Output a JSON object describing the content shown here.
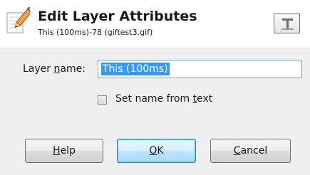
{
  "header": {
    "title": "Edit Layer Attributes",
    "subtitle": "This (100ms)-78 (giftest3.gif)"
  },
  "form": {
    "layer_name_label_pre": "Layer ",
    "layer_name_label_accel": "n",
    "layer_name_label_post": "ame:",
    "layer_name_value": "This (100ms)",
    "set_name_checkbox_checked": false,
    "set_name_label_pre": "Set name from ",
    "set_name_label_accel": "t",
    "set_name_label_post": "ext"
  },
  "buttons": {
    "help_accel": "H",
    "help_rest": "elp",
    "ok_accel": "O",
    "ok_rest": "K",
    "cancel_accel": "C",
    "cancel_rest": "ancel"
  },
  "icons": {
    "header_icon": "pencil-edit-icon",
    "text_tool_icon": "text-tool-icon"
  }
}
